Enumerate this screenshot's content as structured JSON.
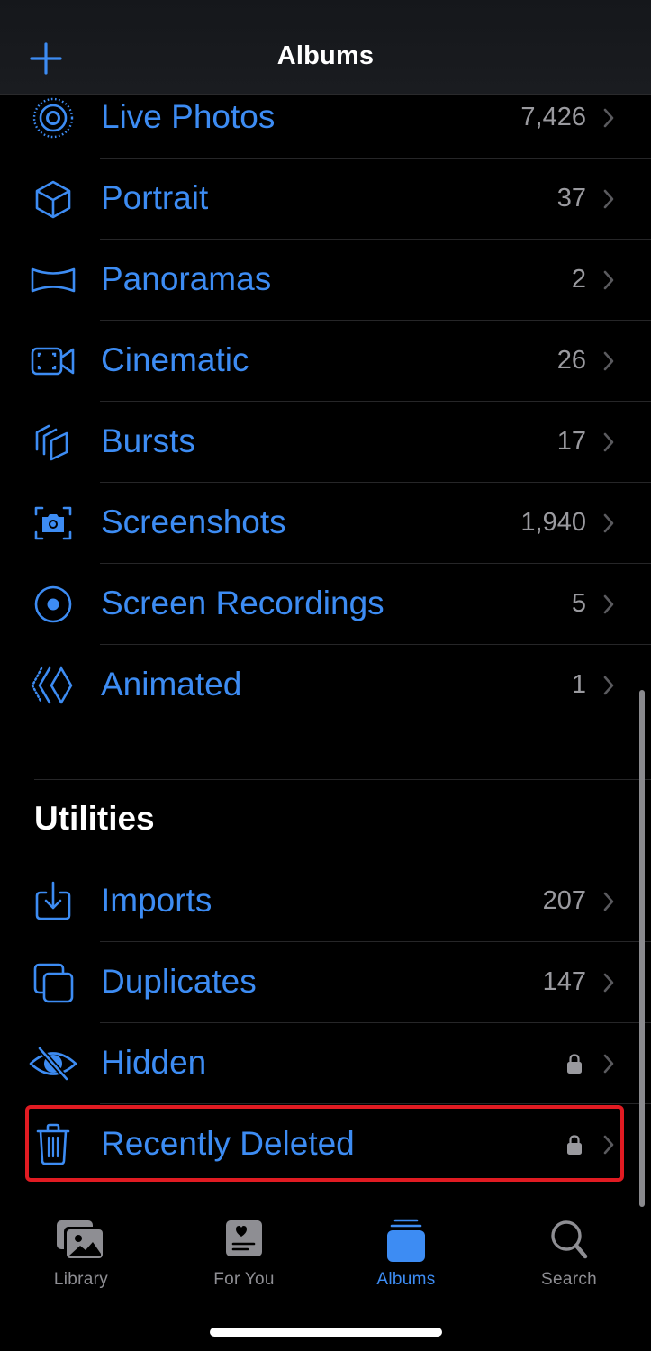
{
  "nav": {
    "title": "Albums",
    "add_icon": "plus-icon"
  },
  "media_types": [
    {
      "label": "Live Photos",
      "count": "7,426",
      "icon": "live-photos-icon"
    },
    {
      "label": "Portrait",
      "count": "37",
      "icon": "cube-icon"
    },
    {
      "label": "Panoramas",
      "count": "2",
      "icon": "panorama-icon"
    },
    {
      "label": "Cinematic",
      "count": "26",
      "icon": "cinematic-video-icon"
    },
    {
      "label": "Bursts",
      "count": "17",
      "icon": "bursts-icon"
    },
    {
      "label": "Screenshots",
      "count": "1,940",
      "icon": "screenshot-camera-icon"
    },
    {
      "label": "Screen Recordings",
      "count": "5",
      "icon": "record-circle-icon"
    },
    {
      "label": "Animated",
      "count": "1",
      "icon": "animated-diamond-icon"
    }
  ],
  "utilities": {
    "header": "Utilities",
    "items": [
      {
        "label": "Imports",
        "count": "207",
        "icon": "import-tray-icon"
      },
      {
        "label": "Duplicates",
        "count": "147",
        "icon": "duplicates-icon"
      },
      {
        "label": "Hidden",
        "count": "",
        "locked": true,
        "icon": "eye-slash-icon"
      },
      {
        "label": "Recently Deleted",
        "count": "",
        "locked": true,
        "icon": "trash-icon",
        "highlighted": true
      }
    ]
  },
  "tabs": [
    {
      "label": "Library",
      "icon": "photo-library-icon",
      "active": false
    },
    {
      "label": "For You",
      "icon": "for-you-heart-card-icon",
      "active": false
    },
    {
      "label": "Albums",
      "icon": "albums-stack-icon",
      "active": true
    },
    {
      "label": "Search",
      "icon": "magnifier-icon",
      "active": false
    }
  ],
  "colors": {
    "accent": "#3d8cf3",
    "count_text": "#9a9a9f",
    "inactive_tab": "#8e8e93",
    "highlight": "#e11b22",
    "background": "#000000"
  }
}
